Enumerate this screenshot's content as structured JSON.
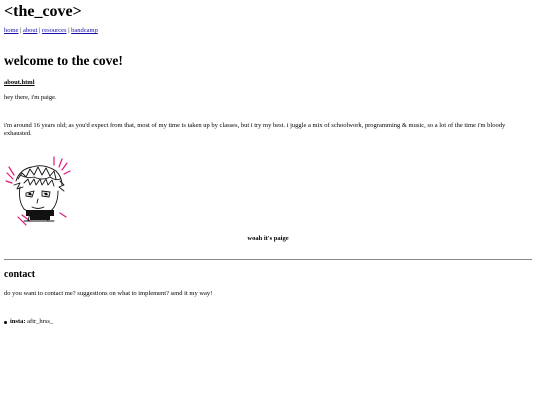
{
  "site": {
    "title": "<the_cove>"
  },
  "nav": {
    "items": [
      {
        "label": "home"
      },
      {
        "label": "about"
      },
      {
        "label": "resources"
      },
      {
        "label": "bandcamp"
      }
    ],
    "separator": "|"
  },
  "main": {
    "welcome_heading": "welcome to the cove!",
    "about_heading": "about.html",
    "intro": "hey there, i'm paige.",
    "bio": "i'm around 16 years old; as you'd expect from that, most of my time is taken up by classes, but i try my best. i juggle a mix of schoolwork, programming & music, so a lot of the time i'm bloody exhausted.",
    "avatar_icon": "doodle-self-portrait",
    "caption": "woah it's paige"
  },
  "contact": {
    "heading": "contact",
    "text": "do you want to contact me? suggestions on what to implement? send it my way!",
    "items": [
      {
        "label": "insta:",
        "value": "aftr_hrss_"
      }
    ]
  },
  "colors": {
    "link": "#1a0dab",
    "doodle_pink": "#e0197a",
    "divider": "#888888"
  }
}
